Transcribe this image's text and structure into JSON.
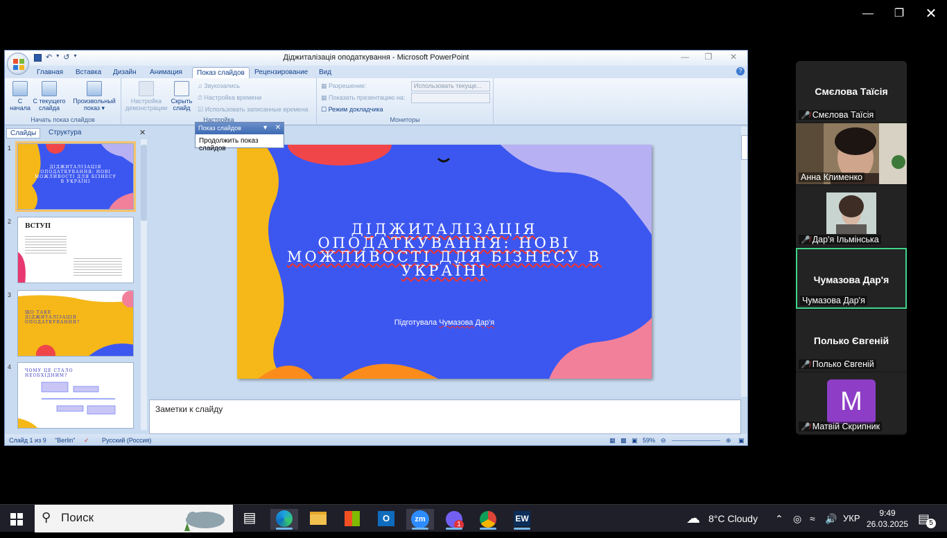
{
  "ppt": {
    "title": "Діджиталізація оподаткування - Microsoft PowerPoint",
    "tabs": [
      "Главная",
      "Вставка",
      "Дизайн",
      "Анимация",
      "Показ слайдов",
      "Рецензирование",
      "Вид"
    ],
    "ribbon": {
      "start_group_label": "Начать показ слайдов",
      "btn_from_start": "С начала",
      "btn_from_current": "С текущего слайда",
      "btn_custom": "Произвольный показ",
      "setup_group_label": "Настройка",
      "btn_setup": "Настройка демонстрации",
      "btn_hide": "Скрыть слайд",
      "record": "Звукозапись",
      "timings": "Настройка времени",
      "use_timings": "Использовать записанные времена",
      "monitors_group_label": "Мониторы",
      "resolution_label": "Разрешение:",
      "resolution_value": "Использовать текуще...",
      "show_on_label": "Показать презентацию на:",
      "presenter_view": "Режим докладчика"
    },
    "left_tabs": [
      "Слайды",
      "Структура"
    ],
    "thumb_titles": {
      "s1": "ДІДЖИТАЛІЗАЦІЯ ОПОДАТКУВАННЯ: НОВІ МОЖЛИВОСТІ ДЛЯ БІЗНЕСУ В УКРАЇНІ",
      "s2": "ВСТУП",
      "s3": "ЩО ТАКЕ ДІДЖИТАЛІЗАЦІЯ ОПОДАТКУВАННЯ?",
      "s4": "ЧОМУ ЦЕ СТАЛО НЕОБХІДНИМ?"
    },
    "slide_numbers": [
      "1",
      "2",
      "3",
      "4"
    ],
    "slide": {
      "title": "ДІДЖИТАЛІЗАЦІЯ ОПОДАТКУВАННЯ: НОВІ МОЖЛИВОСТІ ДЛЯ БІЗНЕСУ В УКРАЇНІ",
      "subtitle_prefix": "Підготувала ",
      "subtitle_name": "Чумазова Дар'я"
    },
    "notes_placeholder": "Заметки к слайду",
    "status": {
      "slide_of": "Слайд 1 из 9",
      "theme": "\"Berlin\"",
      "language": "Русский (Россия)",
      "zoom": "59%"
    },
    "floatbar": {
      "title": "Показ слайдов",
      "item": "Продолжить показ слайдов"
    }
  },
  "participants": [
    {
      "big_name": "Смєлова Таїсія",
      "label": "Смєлова Таїсія",
      "muted": true,
      "type": "name"
    },
    {
      "label": "Анна Клименко",
      "muted": false,
      "type": "video"
    },
    {
      "label": "Дар'я Ільмінська",
      "muted": true,
      "type": "video"
    },
    {
      "big_name": "Чумазова Дар'я",
      "label": "Чумазова Дар'я",
      "muted": false,
      "type": "name",
      "active": true
    },
    {
      "big_name": "Полько Євгеній",
      "label": "Полько Євгеній",
      "muted": true,
      "type": "name"
    },
    {
      "avatar_letter": "M",
      "label": "Матвій Скрипник",
      "muted": true,
      "type": "avatar"
    }
  ],
  "taskbar": {
    "search_placeholder": "Поиск",
    "weather": "8°C  Cloudy",
    "language": "УКР",
    "time": "9:49",
    "date": "26.03.2025",
    "viber_badge": "1",
    "notifications": "5",
    "apps": [
      "task-view",
      "edge",
      "file-explorer",
      "microsoft-store",
      "outlook",
      "zoom",
      "viber",
      "chrome",
      "easyworship"
    ]
  },
  "colors": {
    "slide_bg": "#3c57f0",
    "active_speaker": "#3ed68a",
    "taskbar_bg": "#1f1f2a"
  }
}
